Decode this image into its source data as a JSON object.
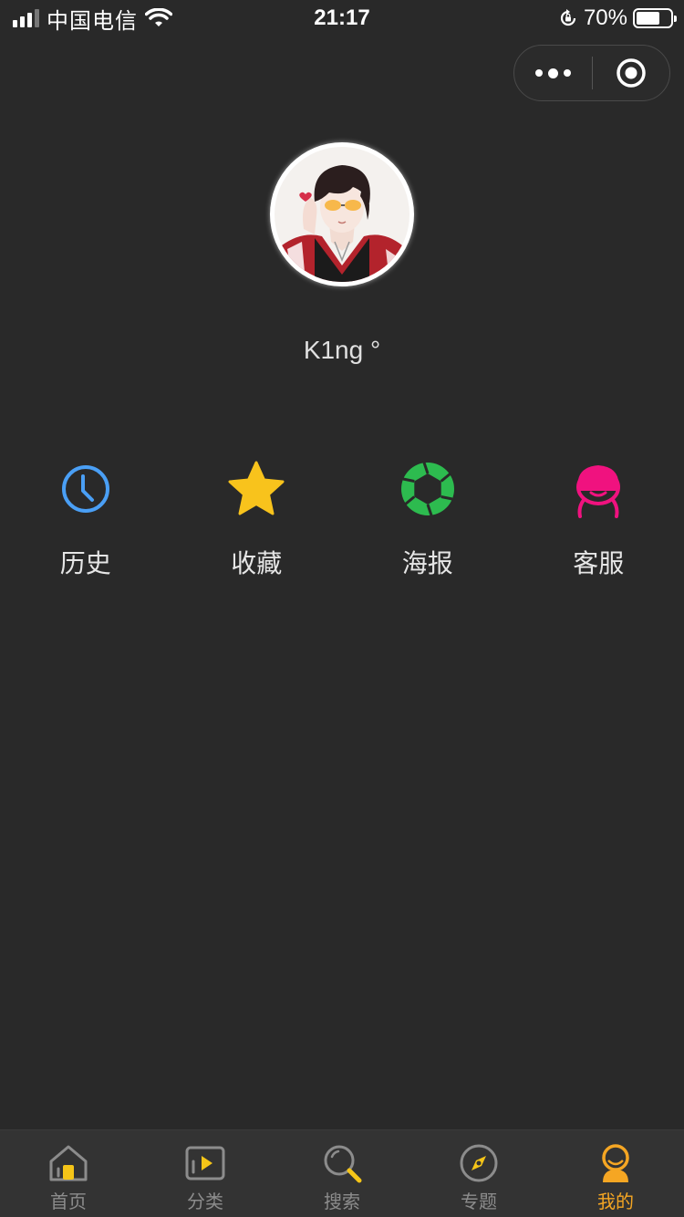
{
  "status_bar": {
    "carrier": "中国电信",
    "time": "21:17",
    "battery_percent": "70%",
    "battery_level": 0.7
  },
  "capsule": {
    "more_icon": "more-dots-icon",
    "close_icon": "target-close-icon"
  },
  "profile": {
    "nickname": "K1ng °",
    "avatar_icon": "user-avatar-image"
  },
  "shortcuts": [
    {
      "label": "历史",
      "icon": "clock-icon",
      "color": "#4a9ff5"
    },
    {
      "label": "收藏",
      "icon": "star-icon",
      "color": "#f8c31c"
    },
    {
      "label": "海报",
      "icon": "aperture-icon",
      "color": "#2dbb4f"
    },
    {
      "label": "客服",
      "icon": "support-person-icon",
      "color": "#f0127f"
    }
  ],
  "tabbar": {
    "active_color": "#f5a623",
    "tabs": [
      {
        "label": "首页",
        "icon": "home-icon",
        "active": false
      },
      {
        "label": "分类",
        "icon": "video-play-icon",
        "active": false
      },
      {
        "label": "搜索",
        "icon": "search-icon",
        "active": false
      },
      {
        "label": "专题",
        "icon": "compass-icon",
        "active": false
      },
      {
        "label": "我的",
        "icon": "user-icon",
        "active": true
      }
    ]
  }
}
